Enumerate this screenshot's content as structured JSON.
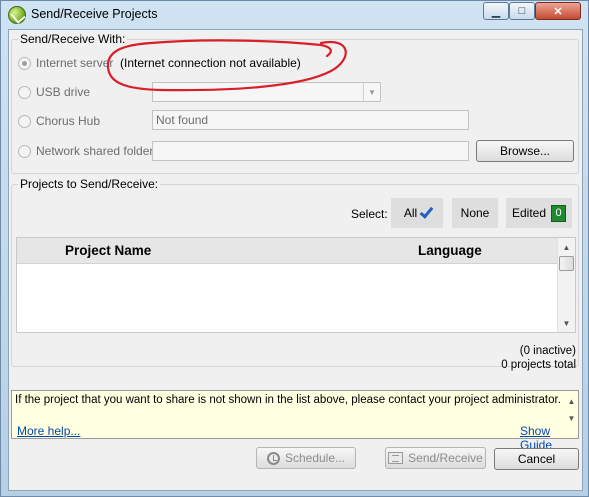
{
  "window": {
    "title": "Send/Receive Projects",
    "controls": {
      "minimize": "▁",
      "maximize": "□",
      "close": "✕"
    }
  },
  "send_with": {
    "group_label": "Send/Receive With:",
    "options": [
      {
        "label": "Internet server",
        "selected": true,
        "status": "(Internet connection not available)"
      },
      {
        "label": "USB drive",
        "selected": false,
        "value": ""
      },
      {
        "label": "Chorus Hub",
        "selected": false,
        "value": "Not found"
      },
      {
        "label": "Network shared folder",
        "selected": false,
        "value": ""
      }
    ],
    "browse_label": "Browse..."
  },
  "projects": {
    "group_label": "Projects to Send/Receive:",
    "select_label": "Select:",
    "select_all": "All",
    "select_none": "None",
    "select_edited": "Edited",
    "edited_count": "0",
    "columns": [
      "Project Name",
      "Language"
    ],
    "rows": []
  },
  "stats": {
    "inactive": "(0 inactive)",
    "total": "0 projects total"
  },
  "info": {
    "message": "If the project that you want to share is not shown in the list above, please contact your project administrator.",
    "more_help": "More help...",
    "show_guide": "Show Guide"
  },
  "buttons": {
    "schedule": "Schedule...",
    "send_receive": "Send/Receive",
    "cancel": "Cancel"
  },
  "colors": {
    "annotation": "#d9202a",
    "edited_badge": "#1f8a2f",
    "check": "#1f5fbf"
  }
}
